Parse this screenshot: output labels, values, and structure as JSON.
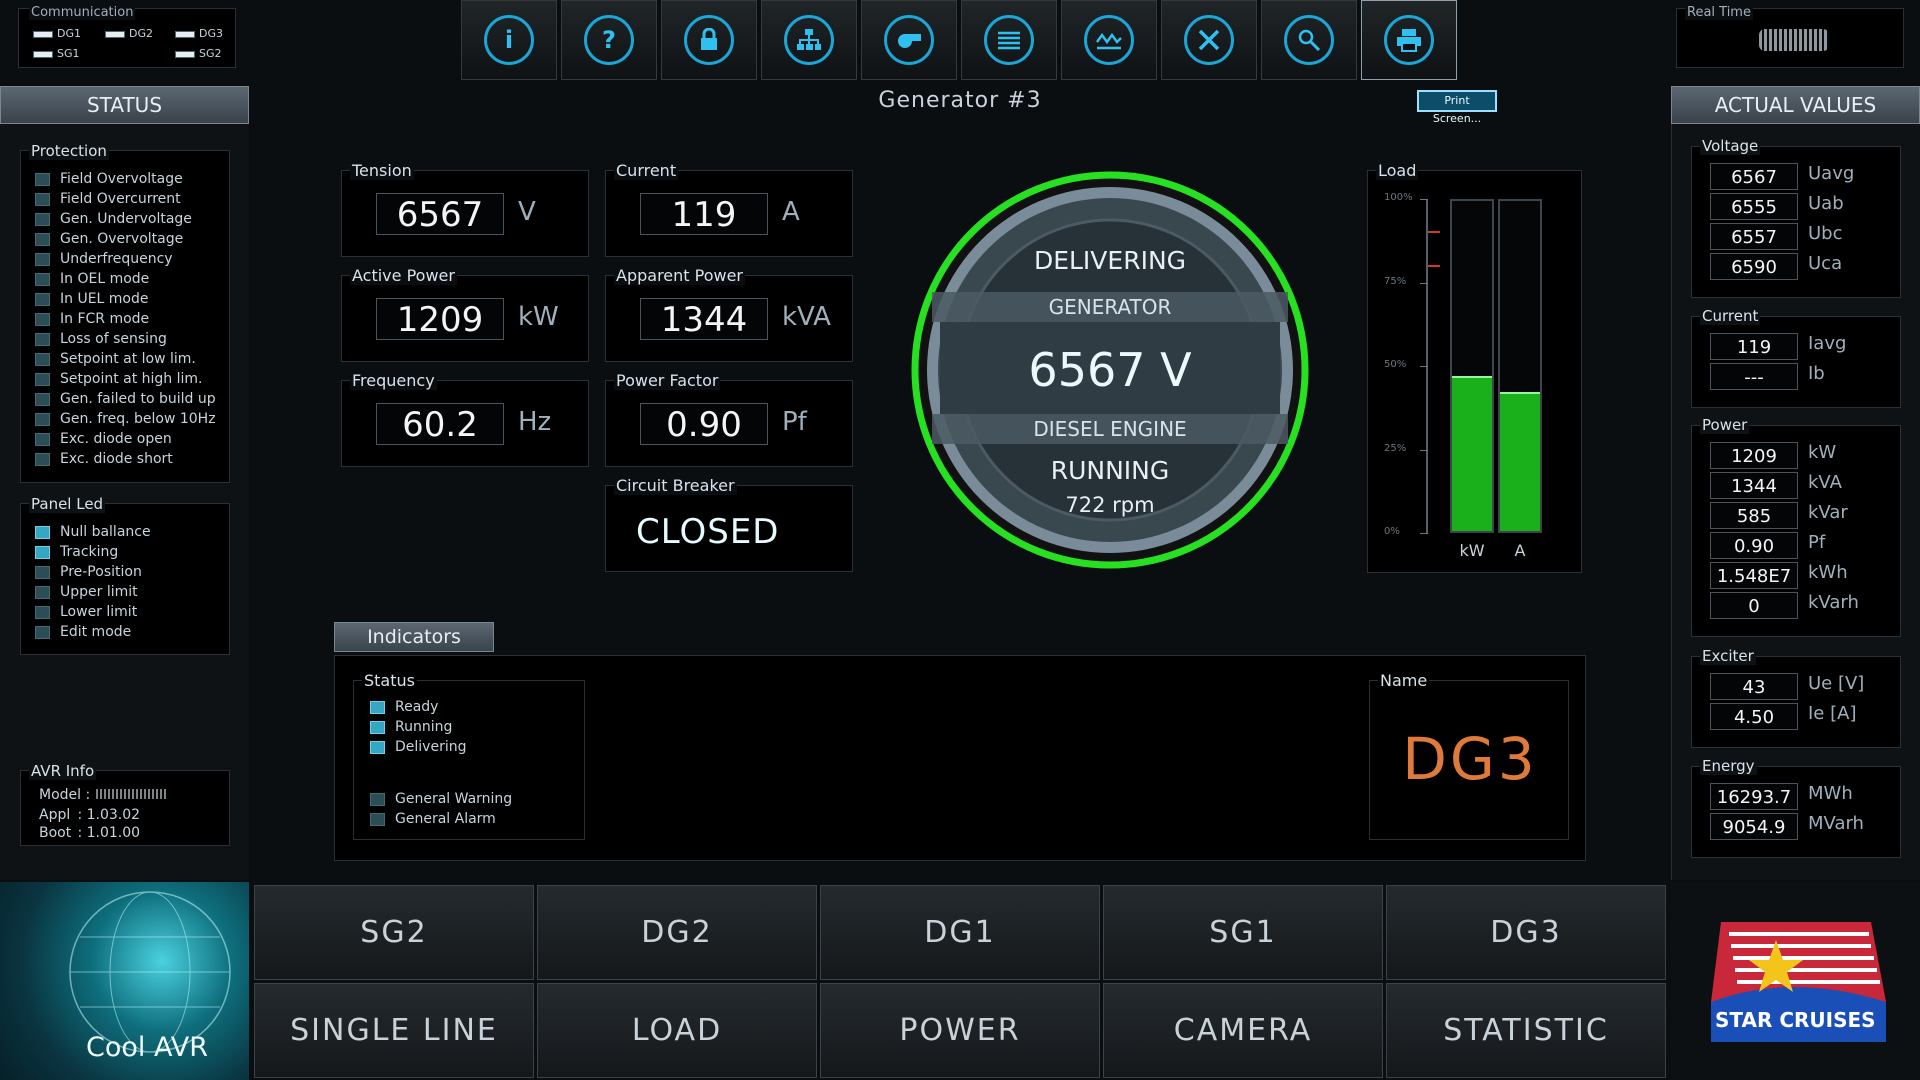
{
  "communication": {
    "title": "Communication",
    "items": [
      "DG1",
      "DG2",
      "DG3",
      "SG1",
      "SG2"
    ]
  },
  "realtime": {
    "title": "Real Time"
  },
  "toolbar": {
    "icons": [
      "info-icon",
      "help-icon",
      "lock-icon",
      "network-icon",
      "whistle-icon",
      "list-icon",
      "trend-icon",
      "tools-icon",
      "search-icon",
      "print-icon"
    ]
  },
  "header": {
    "title": "Generator #3",
    "print_label": "Print Screen..."
  },
  "status": {
    "title": "STATUS",
    "protection_title": "Protection",
    "protection": [
      "Field Overvoltage",
      "Field Overcurrent",
      "Gen. Undervoltage",
      "Gen. Overvoltage",
      "Underfrequency",
      "In OEL mode",
      "In UEL mode",
      "In FCR mode",
      "Loss of sensing",
      "Setpoint at low lim.",
      "Setpoint at high lim.",
      "Gen. failed to build up",
      "Gen. freq. below 10Hz",
      "Exc. diode open",
      "Exc. diode short"
    ],
    "panel_led_title": "Panel Led",
    "panel_led": [
      "Null ballance",
      "Tracking",
      "Pre-Position",
      "Upper limit",
      "Lower limit",
      "Edit mode"
    ],
    "avr_title": "AVR Info",
    "avr_model_label": "Model :",
    "avr_appl_label": "Appl",
    "avr_appl": ": 1.03.02",
    "avr_boot_label": "Boot",
    "avr_boot": ": 1.01.00"
  },
  "measures": {
    "tension": {
      "label": "Tension",
      "value": "6567",
      "unit": "V"
    },
    "current": {
      "label": "Current",
      "value": "119",
      "unit": "A"
    },
    "active_power": {
      "label": "Active Power",
      "value": "1209",
      "unit": "kW"
    },
    "apparent_power": {
      "label": "Apparent Power",
      "value": "1344",
      "unit": "kVA"
    },
    "frequency": {
      "label": "Frequency",
      "value": "60.2",
      "unit": "Hz"
    },
    "power_factor": {
      "label": "Power Factor",
      "value": "0.90",
      "unit": "Pf"
    },
    "breaker": {
      "label": "Circuit Breaker",
      "value": "CLOSED"
    }
  },
  "gauge": {
    "state": "DELIVERING",
    "generator": "GENERATOR",
    "voltage": "6567 V",
    "engine": "DIESEL ENGINE",
    "engine_state": "RUNNING",
    "rpm": "722 rpm",
    "ring_color": "#27e021"
  },
  "load": {
    "title": "Load",
    "ticks": [
      "100%",
      "75%",
      "50%",
      "25%",
      "0%"
    ],
    "bars": [
      {
        "label": "kW",
        "value": 0.47
      },
      {
        "label": "A",
        "value": 0.42
      }
    ],
    "bar_color": "#19b01b"
  },
  "indicators": {
    "tab": "Indicators",
    "status_title": "Status",
    "status_on": [
      "Ready",
      "Running",
      "Delivering"
    ],
    "status_off": [
      "General Warning",
      "General Alarm"
    ],
    "name_title": "Name",
    "name": "DG3",
    "name_color": "#e07a3a"
  },
  "actual": {
    "title": "ACTUAL VALUES",
    "voltage": {
      "title": "Voltage",
      "rows": [
        [
          "6567",
          "Uavg"
        ],
        [
          "6555",
          "Uab"
        ],
        [
          "6557",
          "Ubc"
        ],
        [
          "6590",
          "Uca"
        ]
      ]
    },
    "current": {
      "title": "Current",
      "rows": [
        [
          "119",
          "Iavg"
        ],
        [
          "---",
          "Ib"
        ]
      ]
    },
    "power": {
      "title": "Power",
      "rows": [
        [
          "1209",
          "kW"
        ],
        [
          "1344",
          "kVA"
        ],
        [
          "585",
          "kVar"
        ],
        [
          "0.90",
          "Pf"
        ],
        [
          "1.548E7",
          "kWh"
        ],
        [
          "0",
          "kVarh"
        ]
      ]
    },
    "exciter": {
      "title": "Exciter",
      "rows": [
        [
          "43",
          "Ue [V]"
        ],
        [
          "4.50",
          "Ie  [A]"
        ]
      ]
    },
    "energy": {
      "title": "Energy",
      "rows": [
        [
          "16293.7",
          "MWh"
        ],
        [
          "9054.9",
          "MVarh"
        ]
      ]
    }
  },
  "nav": {
    "row1": [
      "SG2",
      "DG2",
      "DG1",
      "SG1",
      "DG3"
    ],
    "row2": [
      "SINGLE LINE",
      "LOAD",
      "POWER",
      "CAMERA",
      "STATISTIC"
    ]
  },
  "logo_left": "Cool AVR",
  "logo_right": "STAR CRUISES"
}
